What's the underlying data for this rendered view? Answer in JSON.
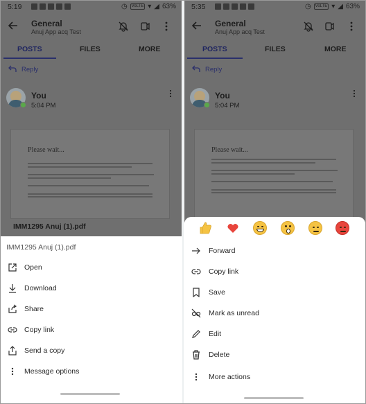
{
  "left": {
    "status": {
      "time": "5:19",
      "battery": "63%"
    },
    "header": {
      "title": "General",
      "subtitle": "Anuj App acq Test"
    },
    "tabs": [
      "POSTS",
      "FILES",
      "MORE"
    ],
    "reply_label": "Reply",
    "message": {
      "sender": "You",
      "time": "5:04 PM"
    },
    "pdf_preview": {
      "heading": "Please wait..."
    },
    "attachment_name": "IMM1295 Anuj (1).pdf",
    "sheet": {
      "title": "IMM1295 Anuj (1).pdf",
      "items": [
        {
          "label": "Open",
          "icon": "open-external-icon"
        },
        {
          "label": "Download",
          "icon": "download-icon"
        },
        {
          "label": "Share",
          "icon": "share-icon"
        },
        {
          "label": "Copy link",
          "icon": "link-icon"
        },
        {
          "label": "Send a copy",
          "icon": "send-copy-icon"
        },
        {
          "label": "Message options",
          "icon": "more-vertical-icon"
        }
      ]
    }
  },
  "right": {
    "status": {
      "time": "5:35",
      "battery": "63%"
    },
    "header": {
      "title": "General",
      "subtitle": "Anuj App acq Test"
    },
    "tabs": [
      "POSTS",
      "FILES",
      "MORE"
    ],
    "reply_label": "Reply",
    "message": {
      "sender": "You",
      "time": "5:04 PM"
    },
    "pdf_preview": {
      "heading": "Please wait..."
    },
    "reactions": [
      "like",
      "heart",
      "laugh",
      "surprised",
      "sad",
      "angry"
    ],
    "sheet": {
      "items": [
        {
          "label": "Forward",
          "icon": "forward-arrow-icon"
        },
        {
          "label": "Copy link",
          "icon": "link-icon"
        },
        {
          "label": "Save",
          "icon": "bookmark-icon"
        },
        {
          "label": "Mark as unread",
          "icon": "unread-icon"
        },
        {
          "label": "Edit",
          "icon": "pencil-icon"
        },
        {
          "label": "Delete",
          "icon": "trash-icon"
        },
        {
          "label": "More actions",
          "icon": "more-vertical-icon"
        }
      ]
    }
  },
  "colors": {
    "accent": "#2a2f6b",
    "dim_overlay": "#6f6f6f",
    "like": "#f5c343",
    "heart": "#e8453c"
  }
}
